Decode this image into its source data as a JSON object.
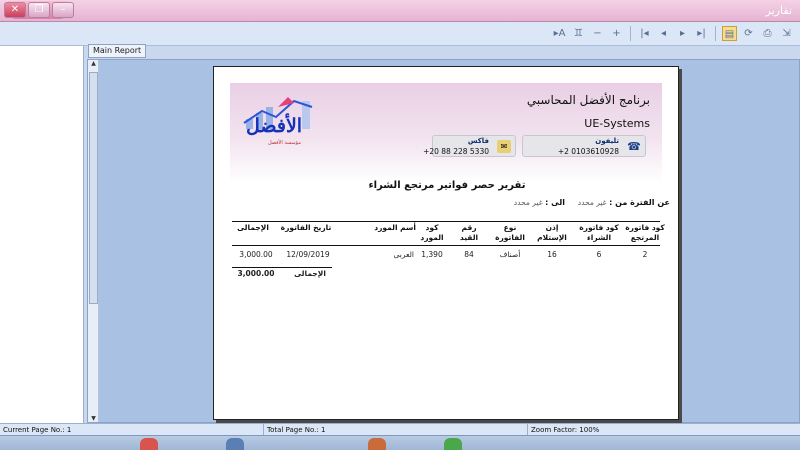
{
  "window": {
    "title": "تقارير"
  },
  "toolbar": {
    "tools": [
      {
        "icon": "goto-icon",
        "glyph": "▸A"
      },
      {
        "icon": "binoculars-icon",
        "glyph": "♊"
      },
      {
        "icon": "zoom-out-icon",
        "glyph": "−"
      },
      {
        "icon": "zoom-in-icon",
        "glyph": "+"
      },
      {
        "icon": "first-page-icon",
        "glyph": "|◂"
      },
      {
        "icon": "prev-page-icon",
        "glyph": "◂"
      },
      {
        "icon": "next-page-icon",
        "glyph": "▸"
      },
      {
        "icon": "last-page-icon",
        "glyph": "▸|"
      },
      {
        "icon": "tree-toggle-icon",
        "glyph": "▤"
      },
      {
        "icon": "refresh-icon",
        "glyph": "⟳"
      },
      {
        "icon": "print-icon",
        "glyph": "⎙"
      },
      {
        "icon": "export-icon",
        "glyph": "⇲"
      }
    ]
  },
  "tab": {
    "label": "Main Report"
  },
  "report": {
    "company_name": "برنامج الأفضل المحاسبي",
    "company_en": "UE-Systems",
    "phone": {
      "label": "تليفون",
      "value": "+2 0103610928"
    },
    "fax": {
      "label": "فاكس",
      "value": "+20 88 228 5330"
    },
    "logo": {
      "text": "الأفضل",
      "sub": "مؤسسة الأفضل"
    },
    "title": "تقرير حصر فواتير مرتجع الشراء",
    "period": {
      "from_label": "عن الفترة من :",
      "from_value": "غير محدد",
      "to_label": "الى :",
      "to_value": "غير محدد"
    },
    "columns": [
      "كود فاتورة المرتجع",
      "كود فاتورة الشراء",
      "إذن الإستلام",
      "نوع الفاتورة",
      "رقم القيد",
      "كود المورد",
      "أسم المورد",
      "تاريخ الفاتورة",
      "الإجمالى"
    ],
    "rows": [
      [
        "2",
        "6",
        "16",
        "أصناف",
        "84",
        "1,390",
        "العربى",
        "12/09/2019",
        "3,000.00"
      ]
    ],
    "total_label": "الإجمالى",
    "total_value": "3,000.00"
  },
  "status": {
    "current_page": "Current Page No.: 1",
    "total_page": "Total Page No.: 1",
    "zoom": "Zoom Factor: 100%"
  }
}
